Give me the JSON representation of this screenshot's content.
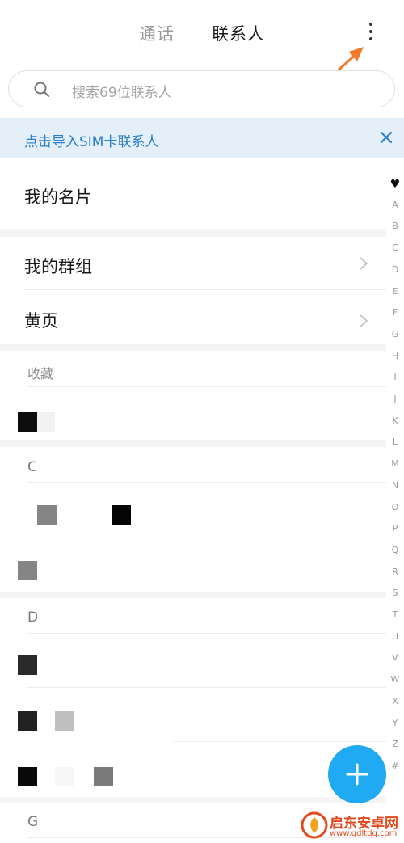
{
  "tabs": {
    "calls": "通话",
    "contacts": "联系人"
  },
  "search": {
    "placeholder": "搜索69位联系人"
  },
  "banner": {
    "text": "点击导入SIM卡联系人"
  },
  "rows": {
    "my_card": "我的名片",
    "my_groups": "我的群组",
    "yellow_pages": "黄页"
  },
  "favorites": {
    "label": "收藏"
  },
  "letters": {
    "c": "C",
    "d": "D",
    "g": "G"
  },
  "index": [
    "♥",
    "A",
    "B",
    "C",
    "D",
    "E",
    "F",
    "G",
    "H",
    "I",
    "J",
    "K",
    "L",
    "M",
    "N",
    "O",
    "P",
    "Q",
    "R",
    "S",
    "T",
    "U",
    "V",
    "W",
    "X",
    "Y",
    "Z",
    "#"
  ],
  "watermark": {
    "title": "启东安卓网",
    "url": "www.qdltdq.com"
  },
  "colors": {
    "accent": "#1faaf3",
    "banner_bg": "#e4eff9",
    "banner_text": "#2a7fca",
    "arrow": "#f07a2a"
  }
}
